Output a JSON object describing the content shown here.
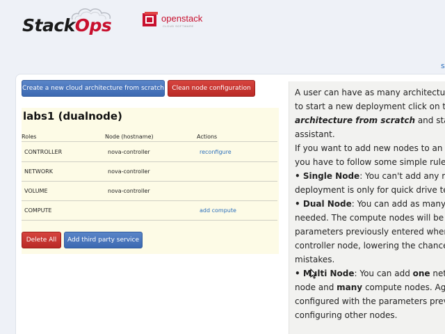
{
  "header": {
    "brand_logo": {
      "prefix": "Stack",
      "suffix": "Ops"
    },
    "partner_logo": {
      "name": "openstack",
      "tagline": "CLOUD SOFTWARE"
    },
    "edge_link": "s"
  },
  "toolbar": {
    "create_label": "Create a new cloud architecture from scratch",
    "clean_label": "Clean node configuration"
  },
  "architecture": {
    "title": "labs1 (dualnode)",
    "columns": [
      "Roles",
      "Node (hostname)",
      "Actions"
    ],
    "rows": [
      {
        "role": "CONTROLLER",
        "node": "nova-controller",
        "action": "reconfigure"
      },
      {
        "role": "NETWORK",
        "node": "nova-controller",
        "action": ""
      },
      {
        "role": "VOLUME",
        "node": "nova-controller",
        "action": ""
      },
      {
        "role": "COMPUTE",
        "node": "",
        "action": "add compute"
      }
    ],
    "delete_label": "Delete All",
    "third_party_label": "Add third party service"
  },
  "help": {
    "l1": "A user can have as many architecture",
    "l2": "to start a new deployment click on the",
    "l3_bold": "architecture from scratch",
    "l3_rest": " and start",
    "l4": "assistant.",
    "l5": "If you want to add new nodes to an exi",
    "l6": "you have to follow some simple rules:",
    "l7_bullet": "• ",
    "l7_bold": "Single Node",
    "l7_rest": ": You can't add any mo",
    "l8": "deployment is only for quick drive test",
    "l9_bullet": "• ",
    "l9_bold": "Dual Node",
    "l9_rest": ": You can add as many c",
    "l10": "needed. The compute nodes will be co",
    "l11": "parameters previously entered when c",
    "l12": "controller node, lowering the chances",
    "l13": "mistakes.",
    "l14_bullet": "• ",
    "l14_bold": "Multi Node",
    "l14_rest1": ": You can add ",
    "l14_bold2": "one",
    "l14_rest2": " netw",
    "l15_a": "node and ",
    "l15_bold": "many",
    "l15_b": " compute nodes. Agai",
    "l16": "configured with the parameters previo",
    "l17": "configuring other nodes."
  },
  "colors": {
    "accent_blue": "#3c69b1",
    "accent_red": "#b92a26",
    "panel_bg": "#fdfbe6",
    "link": "#2a6ebb"
  }
}
